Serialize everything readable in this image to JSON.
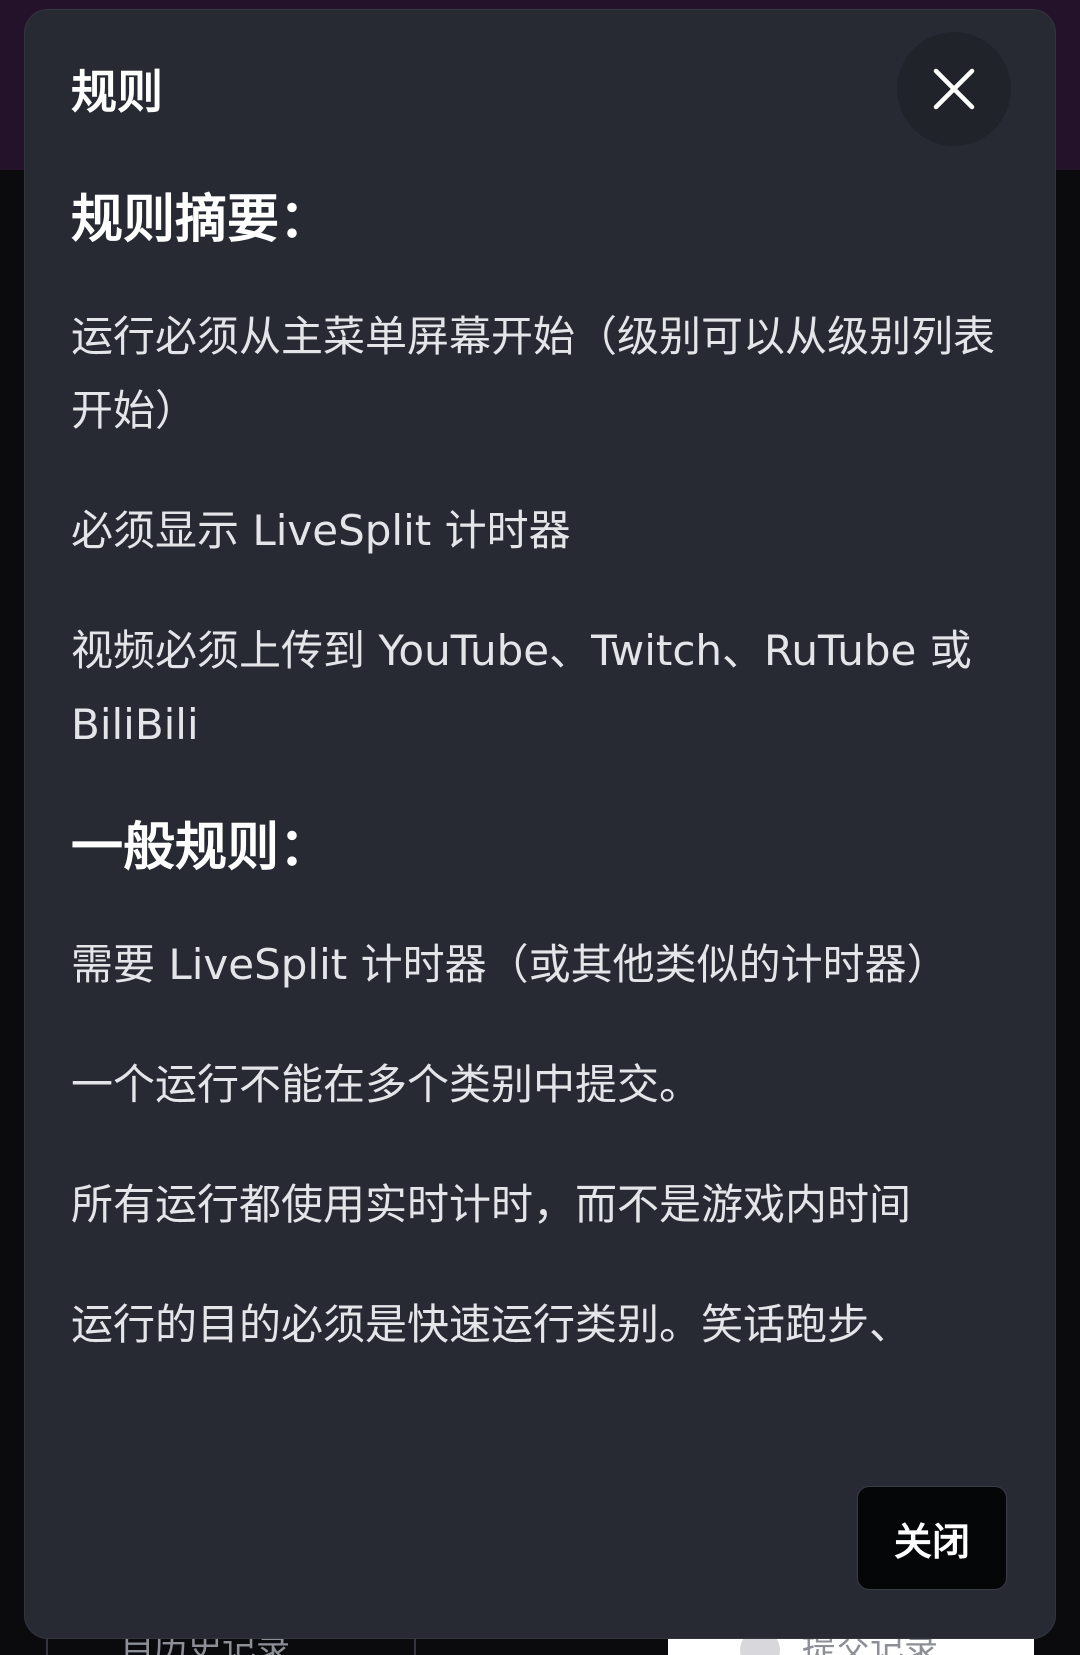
{
  "modal": {
    "title": "规则",
    "footer_close_label": "关闭"
  },
  "summary": {
    "heading": "规则摘要：",
    "rules": [
      "运行必须从主菜单屏幕开始（级别可以从级别列表开始）",
      "必须显示 LiveSplit 计时器",
      "视频必须上传到 YouTube、Twitch、RuTube 或 BiliBili"
    ]
  },
  "general": {
    "heading": "一般规则：",
    "rules": [
      "需要 LiveSplit 计时器（或其他类似的计时器）",
      "一个运行不能在多个类别中提交。",
      "所有运行都使用实时计时，而不是游戏内时间",
      "运行的目的必须是快速运行类别。笑话跑步、"
    ]
  },
  "background": {
    "left_button_label": "自历史记录",
    "right_button_label": "提交记录"
  }
}
